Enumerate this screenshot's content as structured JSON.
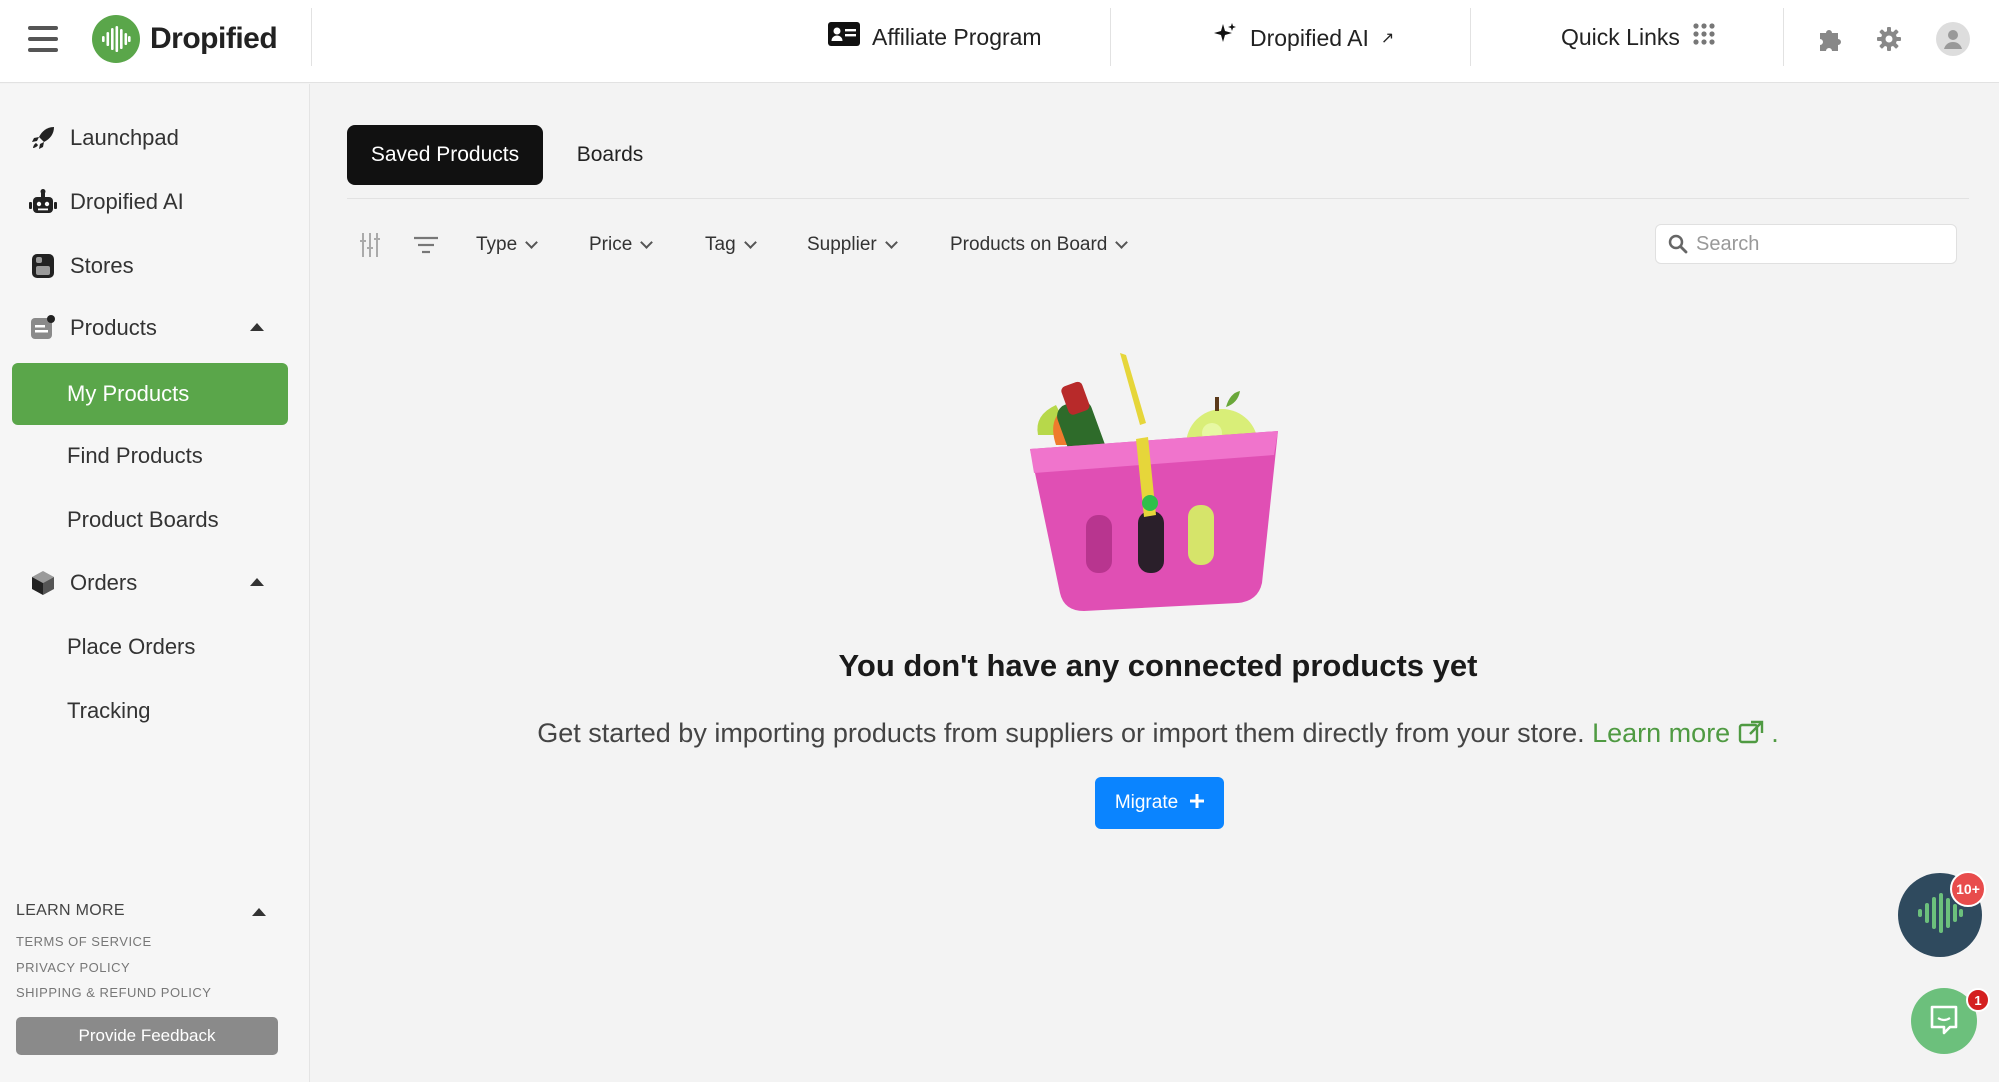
{
  "brand": {
    "name": "Dropified",
    "color": "#5aa64a"
  },
  "topbar": {
    "affiliate_label": "Affiliate Program",
    "ai_label": "Dropified AI",
    "ai_arrow": "↗",
    "quick_links_label": "Quick Links",
    "icons": [
      "menu-icon",
      "id-card-icon",
      "sparkle-icon",
      "grid-icon",
      "puzzle-icon",
      "gear-icon",
      "user-avatar-icon"
    ]
  },
  "sidebar": {
    "items": [
      {
        "label": "Launchpad",
        "icon": "rocket-icon"
      },
      {
        "label": "Dropified AI",
        "icon": "robot-icon"
      },
      {
        "label": "Stores",
        "icon": "store-icon"
      },
      {
        "label": "Products",
        "icon": "products-icon",
        "expanded": true
      },
      {
        "label": "My Products",
        "active": true
      },
      {
        "label": "Find Products"
      },
      {
        "label": "Product Boards"
      },
      {
        "label": "Orders",
        "icon": "box-icon",
        "expanded": true
      },
      {
        "label": "Place Orders"
      },
      {
        "label": "Tracking"
      }
    ],
    "learn_more": {
      "heading": "LEARN MORE",
      "links": [
        "TERMS OF SERVICE",
        "PRIVACY POLICY",
        "SHIPPING & REFUND POLICY"
      ]
    },
    "feedback_label": "Provide Feedback"
  },
  "main": {
    "tabs": [
      {
        "label": "Saved Products",
        "active": true
      },
      {
        "label": "Boards",
        "active": false
      }
    ],
    "filters": [
      "Type",
      "Price",
      "Tag",
      "Supplier",
      "Products on Board"
    ],
    "search": {
      "placeholder": "Search",
      "value": ""
    },
    "empty_state": {
      "illustration": "shopping-basket-illustration",
      "title": "You don't have any connected products yet",
      "description": "Get started by importing products from suppliers or import them directly from your store.",
      "learn_more_label": "Learn more",
      "trailing_period": ".",
      "migrate_label": "Migrate",
      "migrate_icon": "plus-icon"
    }
  },
  "floating": {
    "assistant_badge": "10+",
    "chat_badge": "1"
  },
  "colors": {
    "accent_green": "#5aa64a",
    "primary_blue": "#0a84ff",
    "badge_red": "#e84c4c",
    "assistant_bg": "#2f4a5e"
  }
}
